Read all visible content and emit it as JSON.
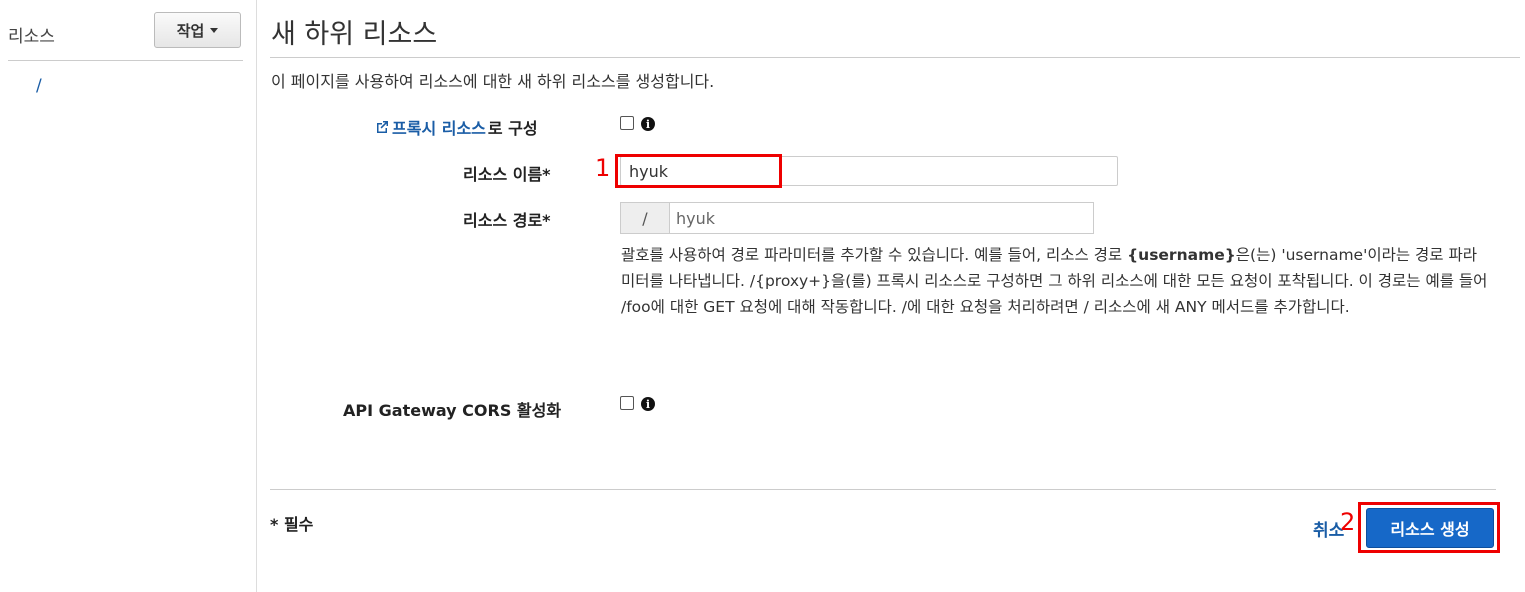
{
  "sidebar": {
    "title": "리소스",
    "actions_label": "작업",
    "tree_root": "/"
  },
  "main": {
    "title": "새 하위 리소스",
    "description": "이 페이지를 사용하여 리소스에 대한 새 하위 리소스를 생성합니다.",
    "proxy": {
      "link_text": "프록시 리소스",
      "suffix": "로 구성",
      "checked": false
    },
    "resource_name": {
      "label": "리소스 이름*",
      "value": "hyuk"
    },
    "resource_path": {
      "label": "리소스 경로*",
      "prefix": "/",
      "value": "hyuk"
    },
    "help": {
      "part1": "괄호를 사용하여 경로 파라미터를 추가할 수 있습니다. 예를 들어, 리소스 경로 ",
      "bold": "{username}",
      "part2": "은(는) 'username'이라는 경로 파라미터를 나타냅니다. /{proxy+}을(를) 프록시 리소스로 구성하면 그 하위 리소스에 대한 모든 요청이 포착됩니다. 이 경로는 예를 들어 /foo에 대한 GET 요청에 대해 작동합니다. /에 대한 요청을 처리하려면 / 리소스에 새 ANY 메서드를 추가합니다."
    },
    "cors": {
      "label": "API Gateway CORS 활성화",
      "checked": false
    },
    "required_note": "* 필수",
    "cancel_label": "취소",
    "create_label": "리소스 생성"
  },
  "annotations": {
    "one": "1",
    "two": "2",
    "color": "#ee0000"
  },
  "icons": {
    "info": "info-icon",
    "external": "external-link-icon",
    "caret": "chevron-down-icon"
  }
}
